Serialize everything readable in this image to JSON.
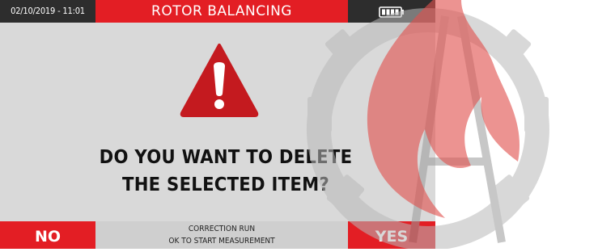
{
  "status_bar": {
    "datetime": "02/10/2019 - 11:01",
    "title": "ROTOR BALANCING",
    "battery_icon": "battery-full-icon"
  },
  "dialog": {
    "warning_icon": "warning-triangle-icon",
    "question_line1": "DO YOU WANT TO DELETE",
    "question_line2": "THE SELECTED ITEM?"
  },
  "bottom_bar": {
    "no_label": "NO",
    "status_line1": "CORRECTION RUN",
    "status_line2": "OK TO START MEASUREMENT",
    "yes_label": "YES"
  },
  "colors": {
    "accent_red": "#e31e24",
    "dark": "#2d2d2d",
    "screen_bg": "#d9d9d9"
  }
}
